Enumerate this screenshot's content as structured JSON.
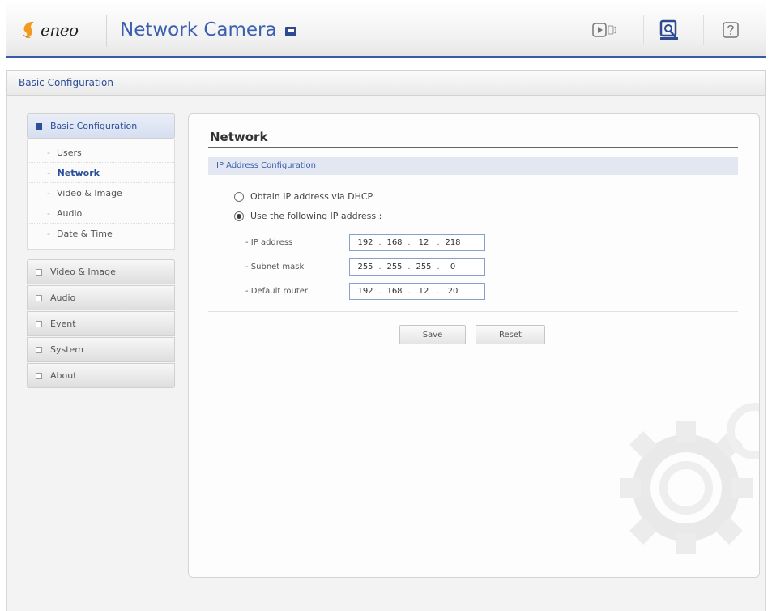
{
  "header": {
    "brand": "eneo",
    "title": "Network Camera",
    "icons": [
      "live-view-icon",
      "setup-icon",
      "help-icon"
    ]
  },
  "breadcrumb": "Basic Configuration",
  "nav": {
    "active_group": "Basic Configuration",
    "sub_items": [
      "Users",
      "Network",
      "Video & Image",
      "Audio",
      "Date & Time"
    ],
    "active_sub": "Network",
    "groups": [
      "Video & Image",
      "Audio",
      "Event",
      "System",
      "About"
    ]
  },
  "main": {
    "title": "Network",
    "section": "IP Address Configuration",
    "radio_dhcp": "Obtain IP address via DHCP",
    "radio_static": "Use the following IP address :",
    "selected": "static",
    "fields": [
      {
        "label": "- IP address",
        "octets": [
          "192",
          "168",
          "12",
          "218"
        ]
      },
      {
        "label": "- Subnet mask",
        "octets": [
          "255",
          "255",
          "255",
          "0"
        ]
      },
      {
        "label": "- Default router",
        "octets": [
          "192",
          "168",
          "12",
          "20"
        ]
      }
    ],
    "save_label": "Save",
    "reset_label": "Reset"
  },
  "colors": {
    "accent": "#3a5fae",
    "header_line": "#3b5aa6",
    "logo_orange": "#f39a1e"
  }
}
